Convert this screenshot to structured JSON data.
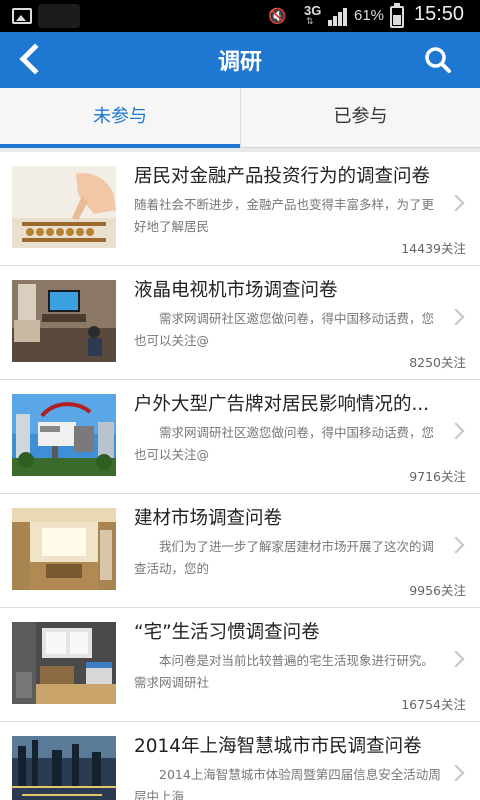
{
  "status_bar": {
    "network": "3G",
    "battery_percent": "61%",
    "battery_level": 0.61,
    "time": "15:50",
    "icons": [
      "image-icon",
      "mute-icon",
      "signal-icon",
      "battery-icon"
    ]
  },
  "header": {
    "title": "调研",
    "back_icon": "back-chevron-icon",
    "search_icon": "search-icon",
    "color": "#1e78d2"
  },
  "tabs": [
    {
      "label": "未参与",
      "active": true
    },
    {
      "label": "已参与",
      "active": false
    }
  ],
  "surveys": [
    {
      "title": "居民对金融产品投资行为的调查问卷",
      "desc": "随着社会不断进步，金融产品也变得丰富多样，为了更好地了解居民",
      "follow": "14439关注"
    },
    {
      "title": "液晶电视机市场调查问卷",
      "desc": "　　需求网调研社区邀您做问卷，得中国移动话费，您也可以关注@",
      "follow": "8250关注"
    },
    {
      "title": "户外大型广告牌对居民影响情况的...",
      "desc": "　　需求网调研社区邀您做问卷，得中国移动话费，您也可以关注@",
      "follow": "9716关注"
    },
    {
      "title": "建材市场调查问卷",
      "desc": "　　我们为了进一步了解家居建材市场开展了这次的调查活动，您的",
      "follow": "9956关注"
    },
    {
      "title": "“宅”生活习惯调查问卷",
      "desc": "　　本问卷是对当前比较普遍的宅生活现象进行研究。需求网调研社",
      "follow": "16754关注"
    },
    {
      "title": "2014年上海智慧城市市民调查问卷",
      "desc": "　　2014上海智慧城市体验周暨第四届信息安全活动周层中上海",
      "follow": ""
    }
  ]
}
